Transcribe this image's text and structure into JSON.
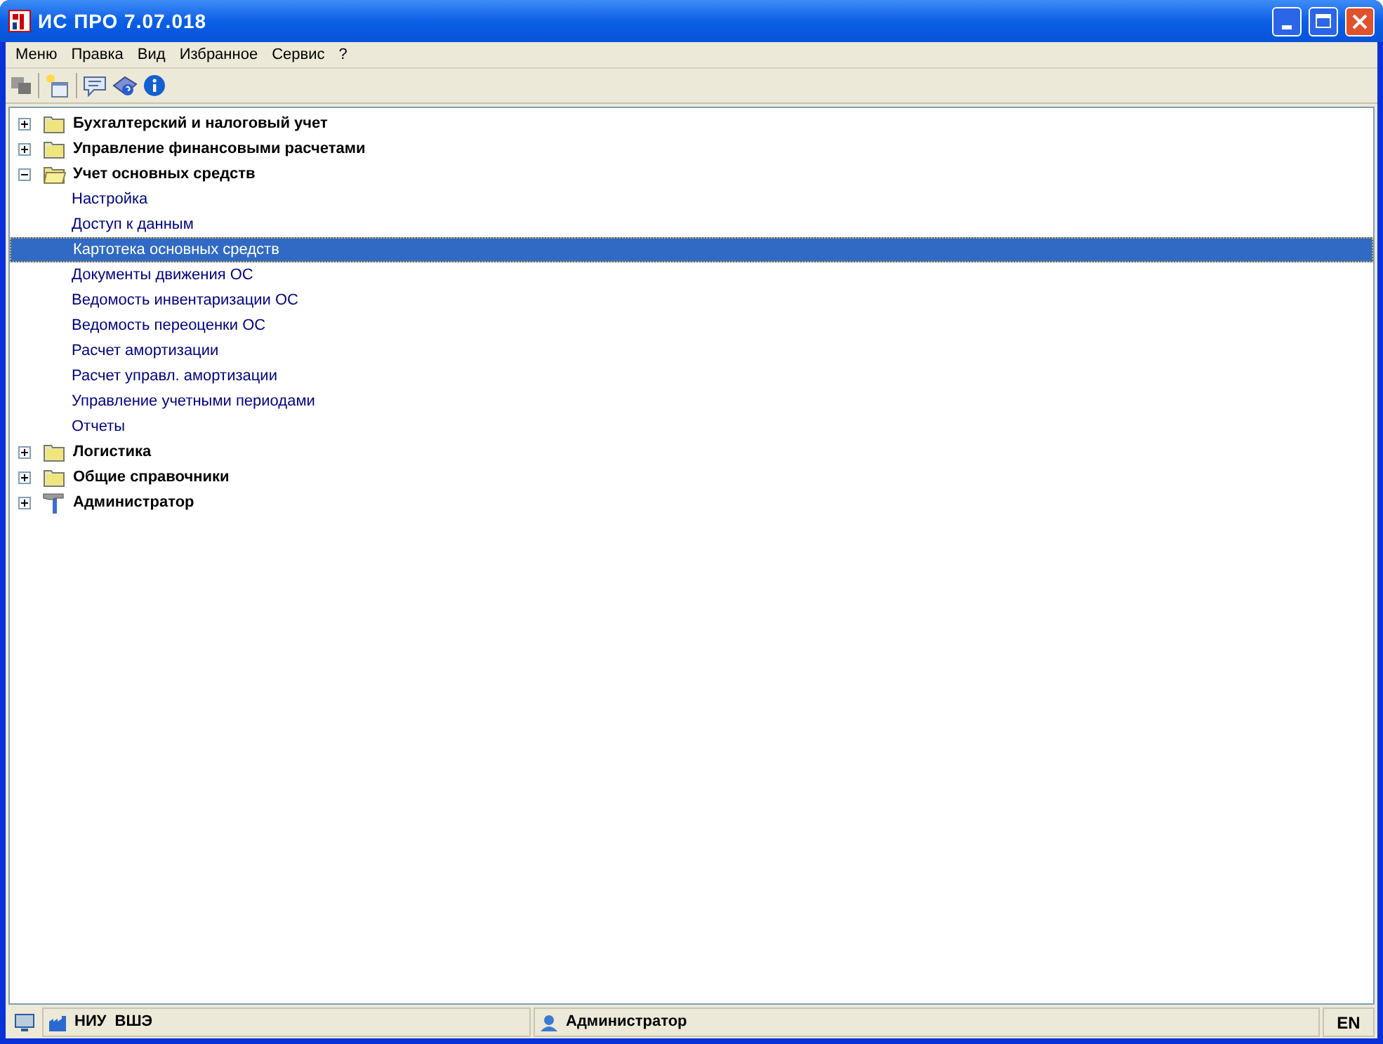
{
  "window": {
    "title": "ИС ПРО 7.07.018"
  },
  "menu": [
    "Меню",
    "Правка",
    "Вид",
    "Избранное",
    "Сервис",
    "?"
  ],
  "tree": [
    {
      "label": "Бухгалтерский и налоговый учет",
      "kind": "folder",
      "expanded": false
    },
    {
      "label": "Управление финансовыми расчетами",
      "kind": "folder",
      "expanded": false
    },
    {
      "label": "Учет основных средств",
      "kind": "folder",
      "expanded": true,
      "children": [
        {
          "label": "Настройка",
          "selected": false
        },
        {
          "label": "Доступ к данным",
          "selected": false
        },
        {
          "label": "Картотека основных средств",
          "selected": true
        },
        {
          "label": "Документы движения ОС",
          "selected": false
        },
        {
          "label": "Ведомость инвентаризации ОС",
          "selected": false
        },
        {
          "label": "Ведомость переоценки ОС",
          "selected": false
        },
        {
          "label": "Расчет амортизации",
          "selected": false
        },
        {
          "label": "Расчет управл. амортизации",
          "selected": false
        },
        {
          "label": "Управление учетными периодами",
          "selected": false
        },
        {
          "label": "Отчеты",
          "selected": false
        }
      ]
    },
    {
      "label": "Логистика",
      "kind": "folder",
      "expanded": false
    },
    {
      "label": "Общие справочники",
      "kind": "folder",
      "expanded": false
    },
    {
      "label": "Администратор",
      "kind": "tool",
      "expanded": false
    }
  ],
  "status_bar": {
    "organization": "НИУ  ВШЭ",
    "user": "Администратор",
    "language": "EN"
  }
}
